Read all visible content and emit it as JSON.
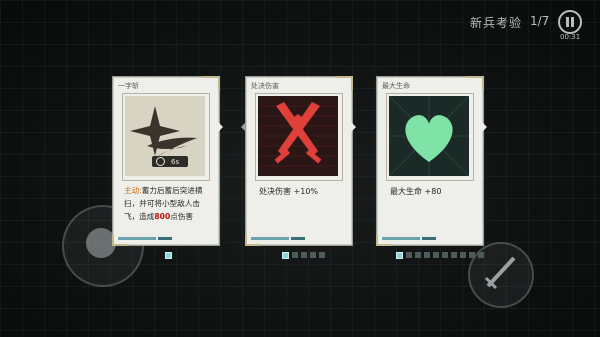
{
  "hud": {
    "mode_title": "新兵考验",
    "progress": "1/7",
    "timer": "00:31",
    "pause_icon": "pause-icon"
  },
  "cards": [
    {
      "title": "一字斩",
      "cooldown": "6s",
      "text_prefix": "主动:",
      "text_main": "蓄力后蓄后突进横扫，并可将小型敌人击飞，造成",
      "damage": "800",
      "text_suffix": "点伤害",
      "icon": "slash-star-icon"
    },
    {
      "title": "处决伤害",
      "stat": "处决伤害 +10%",
      "icon": "crossed-swords-icon"
    },
    {
      "title": "最大生命",
      "stat": "最大生命 +80",
      "icon": "heart-icon"
    }
  ],
  "colors": {
    "accent_cyan": "#8fd7da",
    "damage_red": "#b81414",
    "active_orange": "#c96a12",
    "heart_green": "#7fe3a8",
    "swords_red": "#e0403a"
  }
}
